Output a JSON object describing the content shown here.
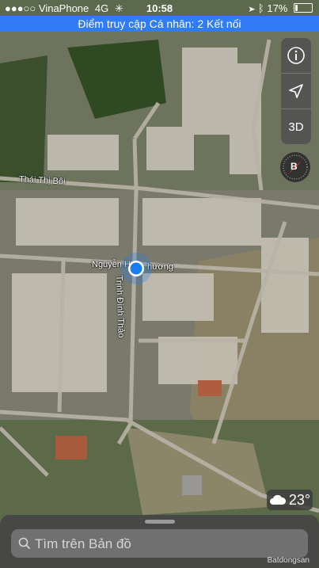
{
  "status_bar": {
    "carrier": "VinaPhone",
    "network": "4G",
    "time": "10:58",
    "battery": "17%",
    "battery_level": 0.17
  },
  "hotspot_banner": "Điểm truy cập Cá nhân: 2 Kết nối",
  "map_controls": {
    "info_icon": "info-icon",
    "location_icon": "location-arrow-icon",
    "view_mode": "3D",
    "compass_label": "B"
  },
  "street_labels": {
    "thai_thi_boi": "Thái Thị Bôi",
    "nguyen_h_phuong": "Nguyễn H",
    "nguyen_h_phuong_tail": "hương",
    "trinh_dinh_thao": "Trịnh Đình Thảo"
  },
  "weather": {
    "icon": "cloud-icon",
    "temperature": "23°"
  },
  "search": {
    "placeholder": "Tìm trên Bản đồ"
  },
  "watermark": "Batdongsan",
  "colors": {
    "banner": "#2f7cf6",
    "location_dot": "#1a7cf0",
    "compass_needle": "#e03a2f"
  }
}
